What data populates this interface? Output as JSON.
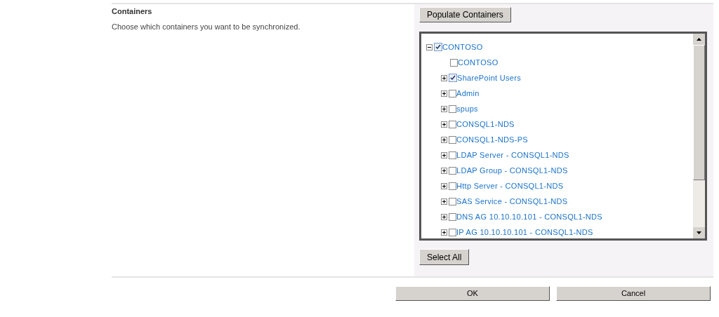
{
  "section": {
    "title": "Containers",
    "description": "Choose which containers you want to be synchronized."
  },
  "populate_button": "Populate Containers",
  "tree": {
    "label": "CONTOSO",
    "kind": "folder",
    "expanded": true,
    "checked": true,
    "children": [
      {
        "label": "CONTOSO",
        "kind": "leaf",
        "checked": false
      },
      {
        "label": "SharePoint Users",
        "kind": "folder",
        "expanded": false,
        "checked": true
      },
      {
        "label": "Admin",
        "kind": "folder",
        "expanded": false,
        "checked": false
      },
      {
        "label": "spups",
        "kind": "folder",
        "expanded": false,
        "checked": false
      },
      {
        "label": "CONSQL1-NDS",
        "kind": "folder",
        "expanded": false,
        "checked": false
      },
      {
        "label": "CONSQL1-NDS-PS",
        "kind": "folder",
        "expanded": false,
        "checked": false
      },
      {
        "label": "LDAP Server - CONSQL1-NDS",
        "kind": "folder",
        "expanded": false,
        "checked": false
      },
      {
        "label": "LDAP Group - CONSQL1-NDS",
        "kind": "folder",
        "expanded": false,
        "checked": false
      },
      {
        "label": "Http Server - CONSQL1-NDS",
        "kind": "folder",
        "expanded": false,
        "checked": false
      },
      {
        "label": "SAS Service - CONSQL1-NDS",
        "kind": "folder",
        "expanded": false,
        "checked": false
      },
      {
        "label": "DNS AG 10.10.10.101 - CONSQL1-NDS",
        "kind": "folder",
        "expanded": false,
        "checked": false
      },
      {
        "label": "IP AG 10.10.10.101 - CONSQL1-NDS",
        "kind": "folder",
        "expanded": false,
        "checked": false
      }
    ]
  },
  "select_all_button": "Select All",
  "footer_buttons": [
    "OK",
    "Cancel"
  ]
}
